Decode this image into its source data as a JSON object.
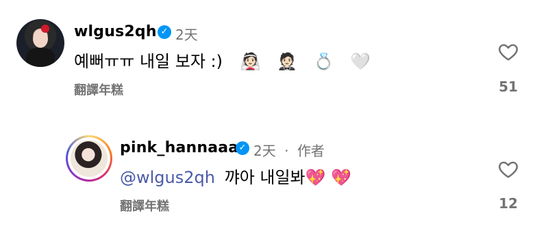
{
  "comments": [
    {
      "username": "wlgus2qh",
      "time": "2天",
      "text": "예뻐ㅠㅠ 내일 보자 :)",
      "emojis": "👰🏻 🤵🏻 💍 🤍",
      "translate_label": "翻譯年糕",
      "likes": "51"
    },
    {
      "username": "pink_hannaaa",
      "time": "2天",
      "separator": "·",
      "author_badge": "作者",
      "mention": "@wlgus2qh",
      "text": "꺄아 내일봐💖 💖",
      "translate_label": "翻譯年糕",
      "likes": "12"
    }
  ],
  "colors": {
    "verified": "#0095f6",
    "secondary_text": "#737373",
    "mention": "#4a5aa8"
  },
  "icons": {
    "verified": "verified-badge-icon",
    "like": "heart-outline-icon"
  }
}
